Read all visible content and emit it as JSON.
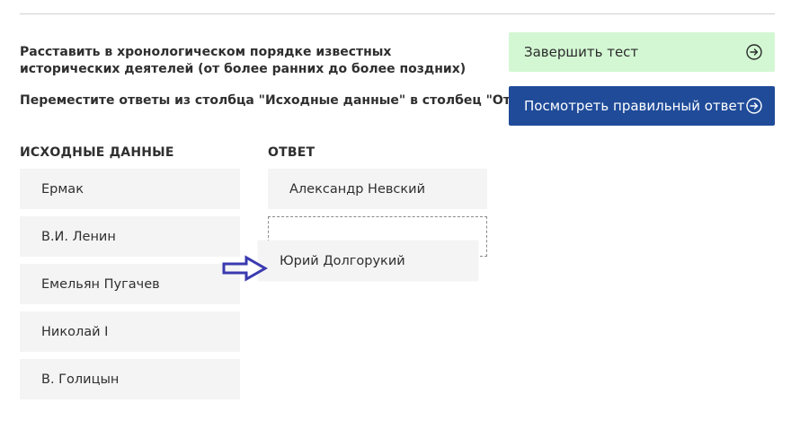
{
  "question": {
    "text": "Расставить в хронологическом порядке известных исторических деятелей (от более ранних до более поздних)",
    "instruction": "Переместите ответы из столбца \"Исходные данные\" в столбец \"Ответ\""
  },
  "buttons": {
    "finish_label": "Завершить тест",
    "show_answer_label": "Посмотреть правильный ответ",
    "icon": "arrow-circle-right-icon",
    "finish_bg": "#d3f7d3",
    "show_answer_bg": "#1f4b99"
  },
  "columns": {
    "source_header": "ИСХОДНЫЕ ДАННЫЕ",
    "answer_header": "ОТВЕТ"
  },
  "source_items": [
    "Ермак",
    "В.И. Ленин",
    "Емельян Пугачев",
    "Николай I",
    "В. Голицын"
  ],
  "answer_items": [
    "Александр Невский"
  ],
  "dragging_item": "Юрий Долгорукий",
  "pointer": {
    "icon": "drag-arrow-icon",
    "color": "#3a3ab0"
  }
}
